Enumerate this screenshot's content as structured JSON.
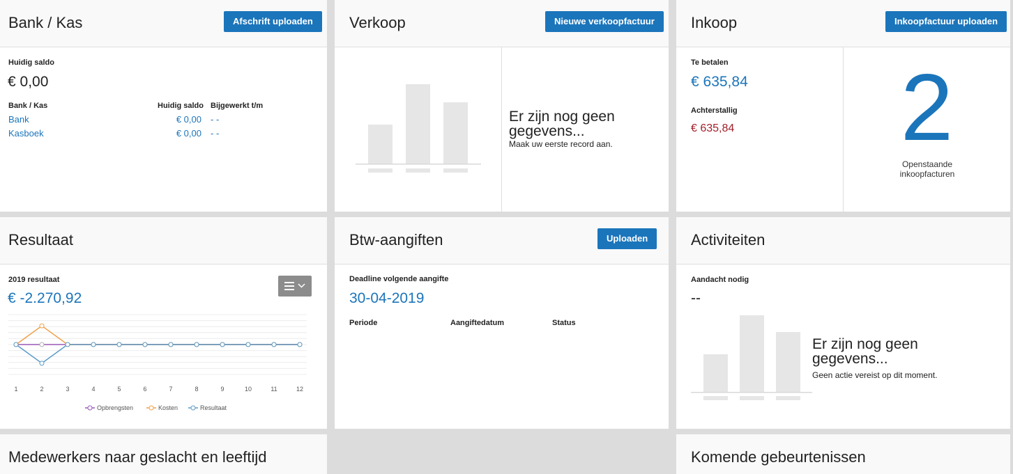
{
  "bank": {
    "title": "Bank / Kas",
    "upload_button": "Afschrift uploaden",
    "current_balance_label": "Huidig saldo",
    "current_balance": "€ 0,00",
    "table_headers": [
      "Bank / Kas",
      "Huidig saldo",
      "Bijgewerkt t/m"
    ],
    "rows": [
      {
        "name": "Bank",
        "balance": "€ 0,00",
        "updated": "- -"
      },
      {
        "name": "Kasboek",
        "balance": "€ 0,00",
        "updated": "- -"
      }
    ]
  },
  "sales": {
    "title": "Verkoop",
    "new_invoice_button": "Nieuwe verkoopfactuur",
    "empty_title": "Er zijn nog geen gegevens...",
    "empty_sub": "Maak uw eerste record aan."
  },
  "purchase": {
    "title": "Inkoop",
    "upload_button": "Inkoopfactuur uploaden",
    "to_pay_label": "Te betalen",
    "to_pay": "€ 635,84",
    "overdue_label": "Achterstallig",
    "overdue": "€ 635,84",
    "open_count": "2",
    "open_label": "Openstaande inkoopfacturen"
  },
  "result": {
    "title": "Resultaat",
    "year_label": "2019 resultaat",
    "year_value": "€ -2.270,92",
    "menu_icon": "hamburger-chevron-icon",
    "chart_data": {
      "type": "line",
      "x": [
        "1",
        "2",
        "3",
        "4",
        "5",
        "6",
        "7",
        "8",
        "9",
        "10",
        "11",
        "12"
      ],
      "series": [
        {
          "name": "Opbrengsten",
          "color": "#9b59b6",
          "values": [
            0,
            0,
            0,
            0,
            0,
            0,
            0,
            0,
            0,
            0,
            0,
            0
          ]
        },
        {
          "name": "Kosten",
          "color": "#f0a04b",
          "values": [
            0,
            1,
            0,
            0,
            0,
            0,
            0,
            0,
            0,
            0,
            0,
            0
          ]
        },
        {
          "name": "Resultaat",
          "color": "#5b9bc8",
          "values": [
            0,
            -1,
            0,
            0,
            0,
            0,
            0,
            0,
            0,
            0,
            0,
            0
          ]
        }
      ],
      "ylim": [
        -1.6,
        1.6
      ],
      "grid": true,
      "legend_position": "bottom"
    }
  },
  "vat": {
    "title": "Btw-aangiften",
    "upload_button": "Uploaden",
    "deadline_label": "Deadline volgende aangifte",
    "deadline": "30-04-2019",
    "headers": [
      "Periode",
      "Aangiftedatum",
      "Status"
    ]
  },
  "activities": {
    "title": "Activiteiten",
    "attention_label": "Aandacht nodig",
    "attention_value": "--",
    "empty_title": "Er zijn nog geen gegevens...",
    "empty_sub": "Geen actie vereist op dit moment."
  },
  "employees": {
    "title": "Medewerkers naar geslacht en leeftijd"
  },
  "events": {
    "title": "Komende gebeurtenissen"
  }
}
